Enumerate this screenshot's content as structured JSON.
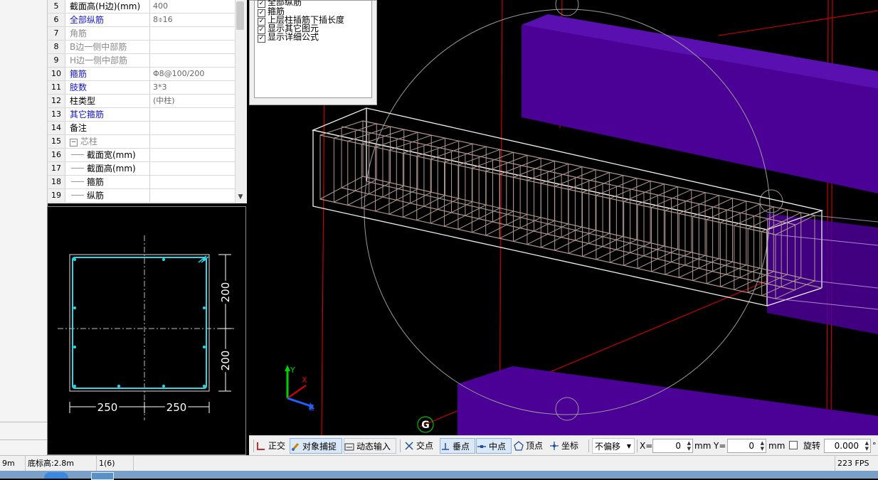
{
  "property_grid": {
    "rows": [
      {
        "no": "5",
        "name": "截面高(H边)(mm)",
        "value": "400",
        "name_color": "black"
      },
      {
        "no": "6",
        "name": "全部纵筋",
        "value": "8⌽16",
        "name_color": "blue"
      },
      {
        "no": "7",
        "name": "角筋",
        "value": "",
        "name_color": "gray"
      },
      {
        "no": "8",
        "name": "B边一侧中部筋",
        "value": "",
        "name_color": "gray"
      },
      {
        "no": "9",
        "name": "H边一侧中部筋",
        "value": "",
        "name_color": "gray"
      },
      {
        "no": "10",
        "name": "箍筋",
        "value": "Φ8@100/200",
        "name_color": "blue"
      },
      {
        "no": "11",
        "name": "肢数",
        "value": "3*3",
        "name_color": "blue"
      },
      {
        "no": "12",
        "name": "柱类型",
        "value": "(中柱)",
        "name_color": "black"
      },
      {
        "no": "13",
        "name": "其它箍筋",
        "value": "",
        "name_color": "blue"
      },
      {
        "no": "14",
        "name": "备注",
        "value": "",
        "name_color": "black"
      },
      {
        "no": "15",
        "name": "芯柱",
        "value": "",
        "name_color": "gray",
        "expander": "−"
      },
      {
        "no": "16",
        "name": "截面宽(mm)",
        "value": "",
        "name_color": "black",
        "child": true
      },
      {
        "no": "17",
        "name": "截面高(mm)",
        "value": "",
        "name_color": "black",
        "child": true
      },
      {
        "no": "18",
        "name": "箍筋",
        "value": "",
        "name_color": "black",
        "child": true
      },
      {
        "no": "19",
        "name": "纵筋",
        "value": "",
        "name_color": "black",
        "child": true
      }
    ]
  },
  "section_preview": {
    "dim_right_top": "200",
    "dim_right_bottom": "200",
    "dim_bottom_left": "250",
    "dim_bottom_right": "250"
  },
  "display_options": [
    {
      "label": "全部纵筋",
      "checked": true
    },
    {
      "label": "箍筋",
      "checked": true
    },
    {
      "label": "上层柱插筋下插长度",
      "checked": true
    },
    {
      "label": "显示其它图元",
      "checked": true
    },
    {
      "label": "显示详细公式",
      "checked": true
    }
  ],
  "viewport": {
    "axis_y": "Y",
    "axis_x": "X",
    "axis_z": "Z",
    "grid_marker": "G"
  },
  "toolbar": {
    "ortho": "正交",
    "snap": "对象捕捉",
    "dynamic_input": "动态输入",
    "intersection": "交点",
    "perpendicular": "垂点",
    "midpoint": "中点",
    "vertex": "顶点",
    "coordinate": "坐标",
    "offset_select": "不偏移",
    "x_label": "X=",
    "x_value": "0",
    "x_unit": "mm",
    "y_label": "Y=",
    "y_value": "0",
    "y_unit": "mm",
    "rotate_label": "旋转",
    "rotate_value": "0.000",
    "rotate_unit": "°"
  },
  "status_bar": {
    "floor_height": "9m",
    "bottom_elev": "底标高:2.8m",
    "count": "1(6)",
    "fps": "223 FPS"
  },
  "colors": {
    "beam_purple": "#4b0096",
    "red_lines": "#c80000",
    "rebar": "#b09890",
    "section_cyan": "#2ed6e6"
  }
}
